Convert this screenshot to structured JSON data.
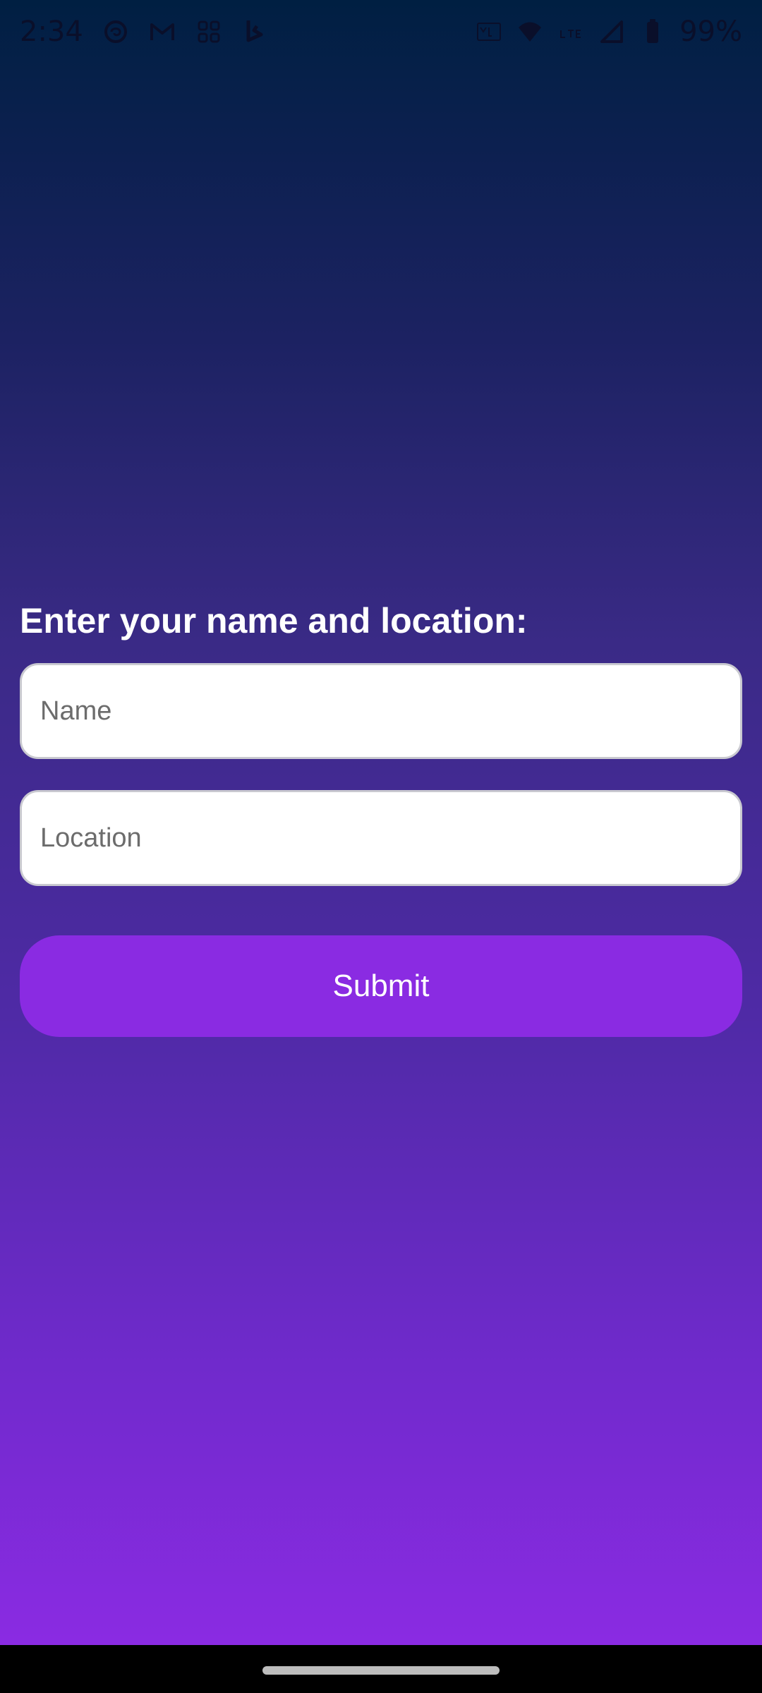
{
  "status_bar": {
    "time": "2:34",
    "battery": "99%",
    "icons_left": [
      "threads-icon",
      "gmail-icon",
      "apps-grid-icon",
      "bing-icon"
    ],
    "icons_right": [
      "volte-icon",
      "wifi-icon",
      "lte-icon",
      "signal-icon",
      "battery-icon"
    ]
  },
  "form": {
    "prompt": "Enter your name and location:",
    "name_placeholder": "Name",
    "location_placeholder": "Location",
    "submit_label": "Submit"
  },
  "colors": {
    "accent": "#8a2be2",
    "background_top": "#001f42",
    "background_bottom": "#8a2be2"
  }
}
